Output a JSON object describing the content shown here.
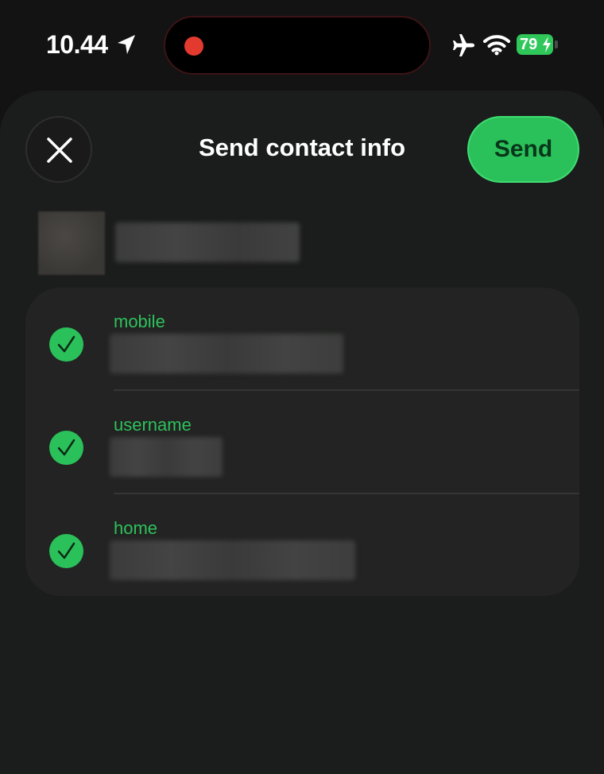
{
  "status_bar": {
    "time": "10.44",
    "battery_level": "79",
    "icons": [
      "location-arrow-icon",
      "airplane-icon",
      "wifi-icon",
      "battery-charging-icon"
    ],
    "recording_indicator_color": "#e33a2f"
  },
  "sheet": {
    "title": "Send contact info",
    "send_label": "Send",
    "close_icon": "close-icon"
  },
  "colors": {
    "accent": "#2bc15a",
    "background": "#131313",
    "sheet": "#1b1c1c",
    "card": "#222322"
  },
  "fields": [
    {
      "label": "mobile",
      "checked": true
    },
    {
      "label": "username",
      "checked": true
    },
    {
      "label": "home",
      "checked": true
    }
  ]
}
